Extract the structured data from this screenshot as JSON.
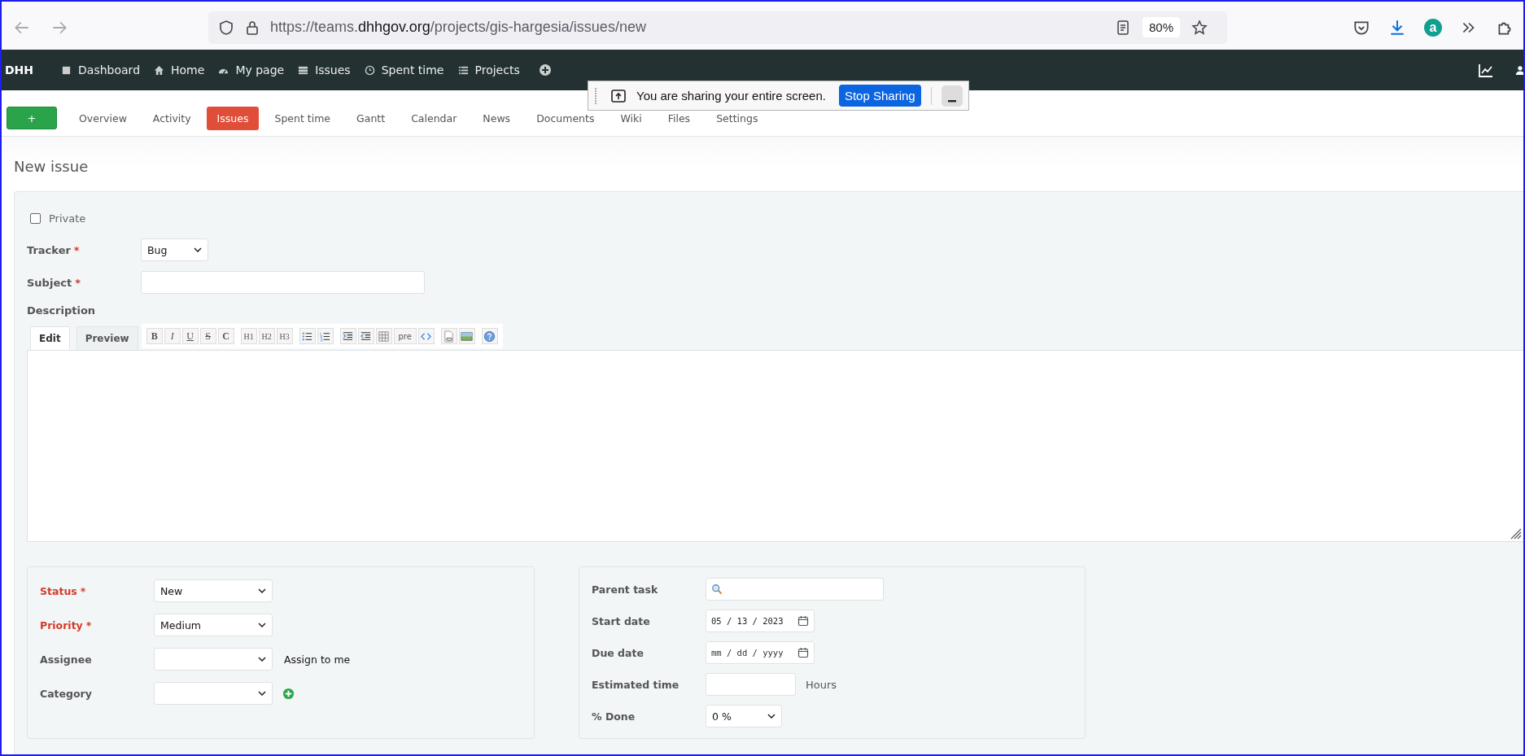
{
  "browser": {
    "url": {
      "prefix": "https://teams.",
      "domain": "dhhgov.org",
      "path": "/projects/gis-hargesia/issues/new"
    },
    "zoom": "80%",
    "extension_letter": "a"
  },
  "top_menu": {
    "brand": "DHH",
    "items": [
      {
        "kind": "square",
        "label": "Dashboard"
      },
      {
        "kind": "home",
        "label": "Home"
      },
      {
        "kind": "gauge",
        "label": "My page"
      },
      {
        "kind": "issues",
        "label": "Issues"
      },
      {
        "kind": "clock",
        "label": "Spent time"
      },
      {
        "kind": "list",
        "label": "Projects"
      }
    ]
  },
  "share_bar": {
    "message": "You are sharing your entire screen.",
    "stop_button": "Stop Sharing"
  },
  "project_menu": {
    "new_button": "+",
    "tabs": [
      {
        "label": "Overview",
        "selected": false
      },
      {
        "label": "Activity",
        "selected": false
      },
      {
        "label": "Issues",
        "selected": true
      },
      {
        "label": "Spent time",
        "selected": false
      },
      {
        "label": "Gantt",
        "selected": false
      },
      {
        "label": "Calendar",
        "selected": false
      },
      {
        "label": "News",
        "selected": false
      },
      {
        "label": "Documents",
        "selected": false
      },
      {
        "label": "Wiki",
        "selected": false
      },
      {
        "label": "Files",
        "selected": false
      },
      {
        "label": "Settings",
        "selected": false
      }
    ]
  },
  "page_title": "New issue",
  "form": {
    "private": {
      "label": "Private",
      "checked": false
    },
    "tracker": {
      "label": "Tracker",
      "required_mark": "*",
      "value": "Bug"
    },
    "subject": {
      "label": "Subject",
      "required_mark": "*"
    },
    "description": {
      "label": "Description",
      "editor_tabs": [
        {
          "label": "Edit",
          "selected": true
        },
        {
          "label": "Preview",
          "selected": false
        }
      ],
      "toolbar": [
        [
          {
            "kind": "bold",
            "label": "B"
          },
          {
            "kind": "italic",
            "label": "I"
          },
          {
            "kind": "underline",
            "label": "U"
          },
          {
            "kind": "strike",
            "label": "S"
          },
          {
            "kind": "inline-code",
            "label": "C"
          }
        ],
        [
          {
            "kind": "heading",
            "label": "H1"
          },
          {
            "kind": "heading",
            "label": "H2"
          },
          {
            "kind": "heading",
            "label": "H3"
          }
        ],
        [
          {
            "kind": "bullet-list"
          },
          {
            "kind": "numbered-list"
          }
        ],
        [
          {
            "kind": "indent"
          },
          {
            "kind": "outdent"
          },
          {
            "kind": "table"
          },
          {
            "kind": "preformatted",
            "label": "pre"
          },
          {
            "kind": "code"
          }
        ],
        [
          {
            "kind": "file-link"
          },
          {
            "kind": "image"
          }
        ],
        [
          {
            "kind": "help"
          }
        ]
      ]
    },
    "left_fields": [
      {
        "kind": "select",
        "label": "Status",
        "required_mark": "*",
        "highlighted": true,
        "value": "New"
      },
      {
        "kind": "select",
        "label": "Priority",
        "required_mark": "*",
        "highlighted": true,
        "value": "Medium"
      },
      {
        "kind": "select",
        "label": "Assignee",
        "highlighted": false,
        "extra": {
          "kind": "link",
          "label": "Assign to me"
        }
      },
      {
        "kind": "select",
        "label": "Category",
        "highlighted": false,
        "extra": {
          "kind": "add"
        }
      }
    ],
    "right_fields": [
      {
        "kind": "search",
        "label": "Parent task"
      },
      {
        "kind": "date",
        "label": "Start date",
        "value": "05 / 13 / 2023"
      },
      {
        "kind": "date",
        "label": "Due date",
        "placeholder": "mm / dd / yyyy"
      },
      {
        "kind": "number",
        "label": "Estimated time",
        "extra": {
          "kind": "unit",
          "label": "Hours"
        }
      },
      {
        "kind": "percent",
        "label": "% Done",
        "value": "0 %"
      }
    ]
  }
}
